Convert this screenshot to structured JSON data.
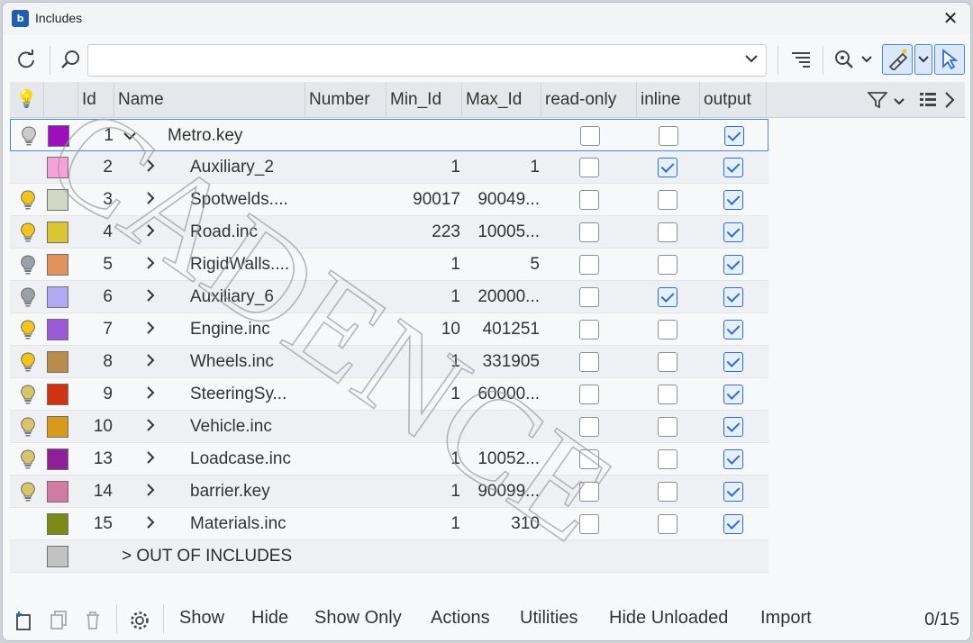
{
  "window": {
    "title": "Includes",
    "app_icon_letter": "b"
  },
  "toolbar": {
    "search_value": "",
    "icons": [
      "refresh-icon",
      "search-icon",
      "filter-list-icon",
      "zoom-icon",
      "highlight-icon",
      "select-pointer-icon"
    ]
  },
  "table": {
    "headers": {
      "id": "Id",
      "name": "Name",
      "number": "Number",
      "min_id": "Min_Id",
      "max_id": "Max_Id",
      "readonly": "read-only",
      "inline": "inline",
      "output": "output"
    },
    "rows": [
      {
        "bulb": "dim",
        "color": "#9b0fbd",
        "id": "1",
        "arrow": "⌄",
        "name": "Metro.key",
        "min": "",
        "max": "",
        "readonly": false,
        "inline": false,
        "output": true,
        "indent": false
      },
      {
        "bulb": "none",
        "color": "#f7a0d9",
        "id": "2",
        "arrow": "›",
        "name": "Auxiliary_2",
        "min": "1",
        "max": "1",
        "readonly": false,
        "inline": true,
        "output": true,
        "indent": true
      },
      {
        "bulb": "on",
        "color": "#d3d8c4",
        "id": "3",
        "arrow": "›",
        "name": "Spotwelds....",
        "min": "90017",
        "max": "90049...",
        "readonly": false,
        "inline": false,
        "output": true,
        "indent": true
      },
      {
        "bulb": "on",
        "color": "#d9c632",
        "id": "4",
        "arrow": "›",
        "name": "Road.inc",
        "min": "223",
        "max": "10005...",
        "readonly": false,
        "inline": false,
        "output": true,
        "indent": true
      },
      {
        "bulb": "off",
        "color": "#e0945c",
        "id": "5",
        "arrow": "›",
        "name": "RigidWalls....",
        "min": "1",
        "max": "5",
        "readonly": false,
        "inline": false,
        "output": true,
        "indent": true
      },
      {
        "bulb": "off",
        "color": "#b3a9f3",
        "id": "6",
        "arrow": "›",
        "name": "Auxiliary_6",
        "min": "1",
        "max": "20000...",
        "readonly": false,
        "inline": true,
        "output": true,
        "indent": true
      },
      {
        "bulb": "on",
        "color": "#9d5ad8",
        "id": "7",
        "arrow": "›",
        "name": "Engine.inc",
        "min": "10",
        "max": "401251",
        "readonly": false,
        "inline": false,
        "output": true,
        "indent": true
      },
      {
        "bulb": "on",
        "color": "#b98c4a",
        "id": "8",
        "arrow": "›",
        "name": "Wheels.inc",
        "min": "1",
        "max": "331905",
        "readonly": false,
        "inline": false,
        "output": true,
        "indent": true
      },
      {
        "bulb": "half",
        "color": "#d0340f",
        "id": "9",
        "arrow": "›",
        "name": "SteeringSy...",
        "min": "1",
        "max": "60000...",
        "readonly": false,
        "inline": false,
        "output": true,
        "indent": true
      },
      {
        "bulb": "half",
        "color": "#d99a1a",
        "id": "10",
        "arrow": "›",
        "name": "Vehicle.inc",
        "min": "",
        "max": "",
        "readonly": false,
        "inline": false,
        "output": true,
        "indent": true
      },
      {
        "bulb": "half",
        "color": "#8e1f99",
        "id": "13",
        "arrow": "›",
        "name": "Loadcase.inc",
        "min": "1",
        "max": "10052...",
        "readonly": false,
        "inline": false,
        "output": true,
        "indent": true
      },
      {
        "bulb": "half",
        "color": "#d07aa4",
        "id": "14",
        "arrow": "›",
        "name": "barrier.key",
        "min": "1",
        "max": "90099...",
        "readonly": false,
        "inline": false,
        "output": true,
        "indent": true
      },
      {
        "bulb": "none",
        "color": "#7d8a16",
        "id": "15",
        "arrow": "›",
        "name": "Materials.inc",
        "min": "1",
        "max": "310",
        "readonly": false,
        "inline": false,
        "output": true,
        "indent": true
      }
    ],
    "out_row": {
      "color": "#c2c2c2",
      "label": "> OUT OF INCLUDES"
    }
  },
  "bottom": {
    "show": "Show",
    "hide": "Hide",
    "show_only": "Show Only",
    "actions": "Actions",
    "utilities": "Utilities",
    "hide_unloaded": "Hide Unloaded",
    "import": "Import",
    "count": "0/15"
  },
  "watermark_text": "CADENCE",
  "colors": {
    "accent": "#2a6fd0",
    "selected_border": "#4a87d8",
    "bulb_on": "#f2c518"
  }
}
